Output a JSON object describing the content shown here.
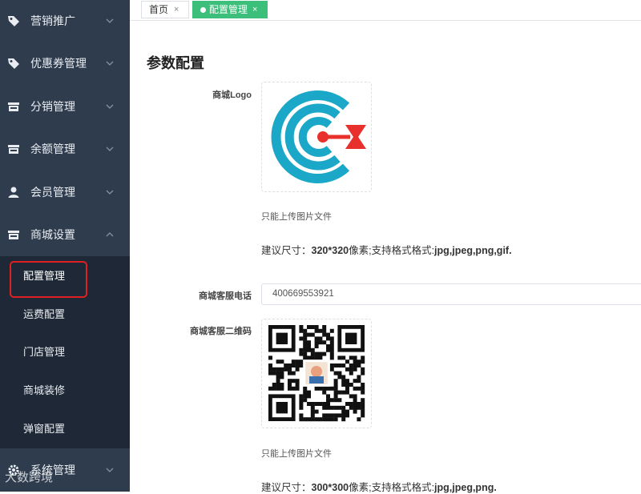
{
  "sidebar": {
    "items": [
      {
        "label": "营销推广",
        "icon": "tag-icon",
        "expanded": false
      },
      {
        "label": "优惠券管理",
        "icon": "tag-icon",
        "expanded": false
      },
      {
        "label": "分销管理",
        "icon": "store-icon",
        "expanded": false
      },
      {
        "label": "余额管理",
        "icon": "store-icon",
        "expanded": false
      },
      {
        "label": "会员管理",
        "icon": "user-icon",
        "expanded": false
      },
      {
        "label": "商城设置",
        "icon": "store-icon",
        "expanded": true
      },
      {
        "label": "系统管理",
        "icon": "gear-icon",
        "expanded": false
      }
    ],
    "submenu": [
      {
        "label": "配置管理",
        "active": true
      },
      {
        "label": "运费配置",
        "active": false
      },
      {
        "label": "门店管理",
        "active": false
      },
      {
        "label": "商城装修",
        "active": false
      },
      {
        "label": "弹窗配置",
        "active": false
      }
    ]
  },
  "tabs": [
    {
      "label": "首页",
      "close": "×",
      "active": false
    },
    {
      "label": "配置管理",
      "close": "×",
      "active": true
    }
  ],
  "main": {
    "title": "参数配置",
    "logo": {
      "label": "商城Logo",
      "hint": "只能上传图片文件",
      "suggest_prefix": "建议尺寸：",
      "suggest_size": "320*320",
      "suggest_mid": "像素;支持格式格式:",
      "suggest_formats": "jpg,jpeg,png,gif."
    },
    "phone": {
      "label": "商城客服电话",
      "value": "400669553921"
    },
    "qrcode": {
      "label": "商城客服二维码",
      "hint": "只能上传图片文件",
      "suggest_prefix": "建议尺寸：",
      "suggest_size": "300*300",
      "suggest_mid": "像素;支持格式格式:",
      "suggest_formats": "jpg,jpeg,png."
    }
  },
  "watermark": "大数跨境",
  "colors": {
    "sidebar_bg": "#2f3c4e",
    "submenu_bg": "#1e2836",
    "accent": "#3cbf7a",
    "highlight": "#e02020",
    "logo_blue": "#1ba7c8",
    "logo_red": "#e8302d"
  }
}
